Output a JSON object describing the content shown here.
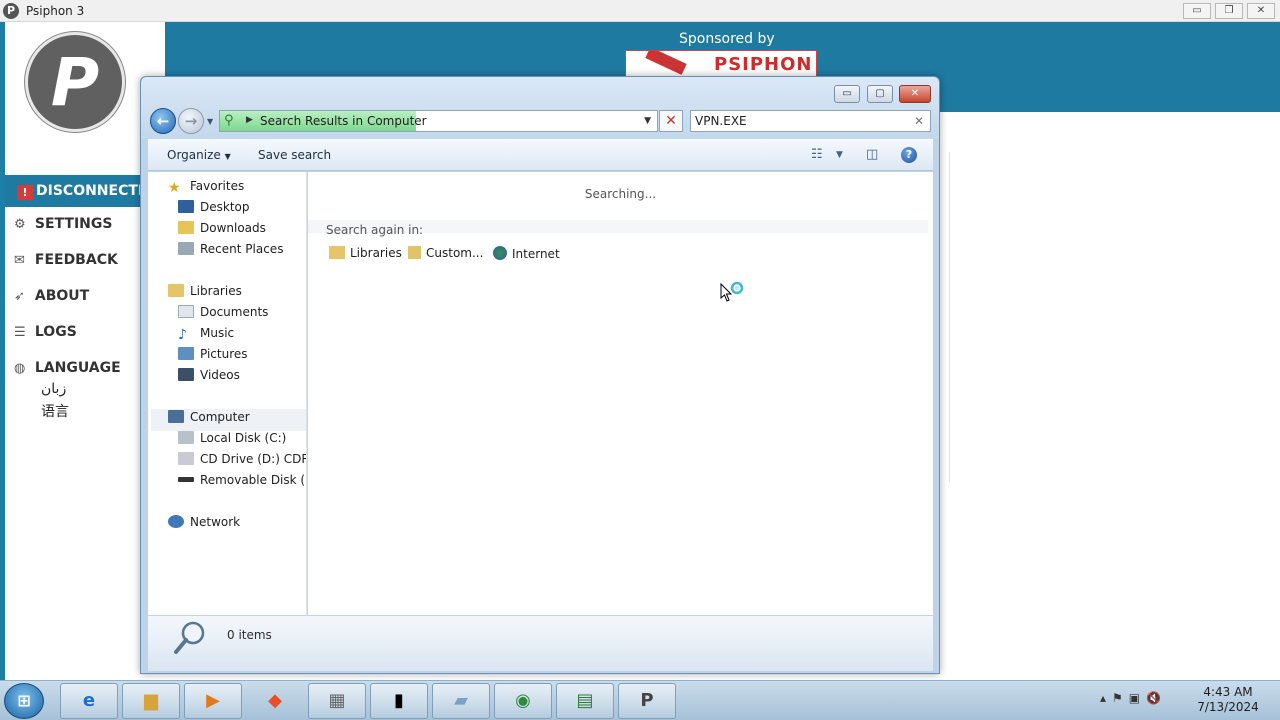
{
  "psiphon": {
    "title": "Psiphon 3",
    "logo_letter": "P",
    "status": "DISCONNECTED",
    "nav": [
      "SETTINGS",
      "FEEDBACK",
      "ABOUT",
      "LOGS",
      "LANGUAGE"
    ],
    "language_options": [
      "زبان",
      "语言"
    ],
    "sponsored_by": "Sponsored by",
    "ad_text": "PSIPHON"
  },
  "explorer": {
    "window_buttons": {
      "minimize": "▭",
      "maximize": "▢",
      "close": "✕"
    },
    "address": {
      "location": "Search Results in Computer"
    },
    "search_box": {
      "value": "VPN.EXE"
    },
    "toolbar": {
      "organize": "Organize",
      "save_search": "Save search"
    },
    "nav_pane": {
      "favorites": {
        "label": "Favorites",
        "items": [
          "Desktop",
          "Downloads",
          "Recent Places"
        ]
      },
      "libraries": {
        "label": "Libraries",
        "items": [
          "Documents",
          "Music",
          "Pictures",
          "Videos"
        ]
      },
      "computer": {
        "label": "Computer",
        "items": [
          "Local Disk (C:)",
          "CD Drive (D:) CDROM",
          "Removable Disk (E:)"
        ]
      },
      "network": {
        "label": "Network"
      }
    },
    "content": {
      "status_text": "Searching...",
      "search_again_label": "Search again in:",
      "search_again_options": [
        "Libraries",
        "Custom...",
        "Internet"
      ]
    },
    "status_bar": {
      "item_count": "0 items"
    }
  },
  "taskbar": {
    "clock_time": "4:43 AM",
    "clock_date": "7/13/2024"
  },
  "colors": {
    "psiphon_blue": "#1f7aa1",
    "disconnected_red": "#d43b3b",
    "explorer_frame": "#bcd3ea",
    "search_progress_green": "#7fd88f"
  }
}
